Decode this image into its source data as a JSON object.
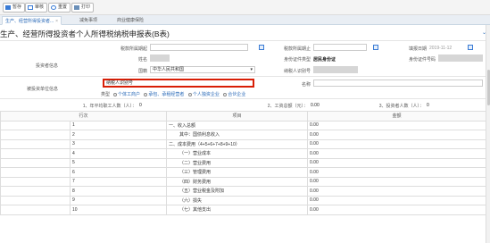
{
  "toolbar": {
    "save": "暂存",
    "check": "审核",
    "reset": "重置",
    "print": "打印"
  },
  "tabs": [
    {
      "label": "生产、经营所得投资者...",
      "close": "×"
    },
    {
      "label": "减免事项"
    },
    {
      "label": "商业健康保险"
    }
  ],
  "title": "生产、经营所得投资者个人所得税纳税申报表(B表)",
  "collapse": "⌄",
  "header": {
    "period_start_label": "税款所属期起",
    "period_end_label": "税款所属期止",
    "fill_date_label": "填报日期",
    "fill_date_value": "2019-11-12",
    "name_label": "姓名",
    "id_type_label": "身份证件类型",
    "id_type_value": "居民身份证",
    "id_no_label": "身份证件号码",
    "investor_info_label": "投资者信息",
    "nationality_label": "国籍",
    "nationality_value": "中华人民共和国",
    "taxpayer_id_label": "纳税人识别号",
    "invested_unit_label": "被投资单位信息",
    "unit_taxpayer_id_label": "纳税人识别号",
    "unit_name_label": "名称",
    "type_label": "类型",
    "type_options": [
      "个体工商户",
      "承包、承租经营者",
      "个人独资企业",
      "合伙企业"
    ]
  },
  "summary": {
    "employees_label": "1、年平均职工人数（人）：",
    "employees_value": "0",
    "wages_label": "2、工资总额（元）：",
    "wages_value": "0.00",
    "investors_label": "3、投资者人数（人）：",
    "investors_value": "0"
  },
  "table": {
    "col_row": "行次",
    "col_item": "项目",
    "col_amount": "金额",
    "rows": [
      {
        "no": "1",
        "item": "一、收入总额",
        "amount": "0.00"
      },
      {
        "no": "2",
        "item": "其中：国债利息收入",
        "amount": "0.00"
      },
      {
        "no": "3",
        "item": "二、成本费用（4+5+6+7+8+9+10）",
        "amount": "0.00"
      },
      {
        "no": "4",
        "item": "（一）营业成本",
        "amount": "0.00"
      },
      {
        "no": "5",
        "item": "（二）营业费用",
        "amount": "0.00"
      },
      {
        "no": "6",
        "item": "（三）管理费用",
        "amount": "0.00"
      },
      {
        "no": "7",
        "item": "（四）财务费用",
        "amount": "0.00"
      },
      {
        "no": "8",
        "item": "（五）营业税金及附加",
        "amount": "0.00"
      },
      {
        "no": "9",
        "item": "（六）损失",
        "amount": "0.00"
      },
      {
        "no": "10",
        "item": "（七）其他支出",
        "amount": "0.00"
      }
    ]
  },
  "colors": {
    "accent": "#2a6ab8",
    "highlight_border": "#d81e06"
  }
}
